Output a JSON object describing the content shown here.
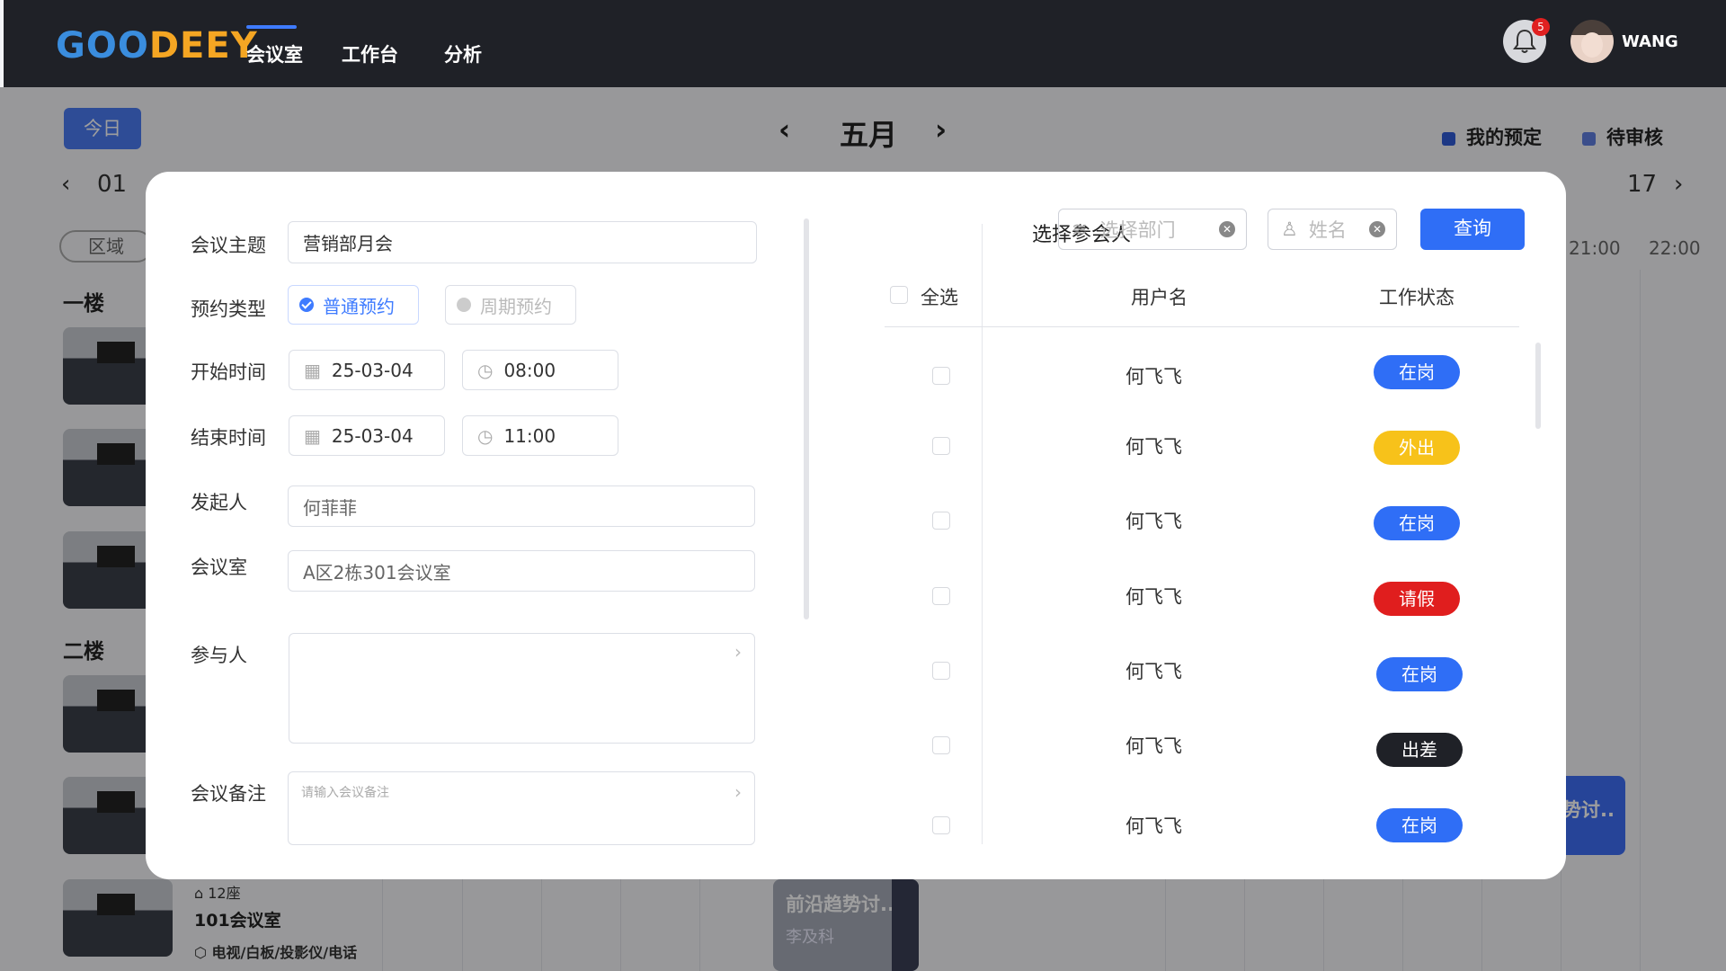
{
  "header": {
    "logo": "GOODEEY",
    "nav": [
      "会议室",
      "工作台",
      "分析"
    ],
    "notification_count": "5",
    "username": "WANG"
  },
  "calendar": {
    "today_label": "今日",
    "month": "五月",
    "legend": [
      {
        "label": "我的预定",
        "color": "#2f5bd7"
      },
      {
        "label": "待审核",
        "color": "#5f7ee0"
      }
    ],
    "date_start": "01",
    "date_end": "17",
    "area_label": "区域",
    "floors": [
      "一楼",
      "二楼"
    ],
    "time_labels": [
      "21:00",
      "22:00"
    ],
    "room": {
      "seats": "12座",
      "name": "101会议室",
      "equipment": "电视/白板/投影仪/电话"
    },
    "event": {
      "title": "前沿趋势讨..",
      "person": "李及科"
    },
    "event2_title": "势讨.."
  },
  "form": {
    "topic_label": "会议主题",
    "topic_value": "营销部月会",
    "type_label": "预约类型",
    "type_normal": "普通预约",
    "type_periodic": "周期预约",
    "start_label": "开始时间",
    "start_date": "25-03-04",
    "start_time": "08:00",
    "end_label": "结束时间",
    "end_date": "25-03-04",
    "end_time": "11:00",
    "initiator_label": "发起人",
    "initiator_value": "何菲菲",
    "room_label": "会议室",
    "room_value": "A区2栋301会议室",
    "participants_label": "参与人",
    "notes_label": "会议备注",
    "notes_placeholder": "请输入会议备注"
  },
  "picker": {
    "title": "选择参会人",
    "dept_placeholder": "选择部门",
    "name_placeholder": "姓名",
    "query_button": "查询",
    "col_select_all": "全选",
    "col_username": "用户名",
    "col_status": "工作状态",
    "rows": [
      {
        "name": "何飞飞",
        "status": "在岗",
        "color": "#2f6ef6"
      },
      {
        "name": "何飞飞",
        "status": "外出",
        "color": "#f7c21a"
      },
      {
        "name": "何飞飞",
        "status": "在岗",
        "color": "#2f6ef6"
      },
      {
        "name": "何飞飞",
        "status": "请假",
        "color": "#e01e1e"
      },
      {
        "name": "何飞飞",
        "status": "在岗",
        "color": "#2f6ef6"
      },
      {
        "name": "何飞飞",
        "status": "出差",
        "color": "#1f2127"
      },
      {
        "name": "何飞飞",
        "status": "在岗",
        "color": "#2f6ef6"
      }
    ]
  }
}
